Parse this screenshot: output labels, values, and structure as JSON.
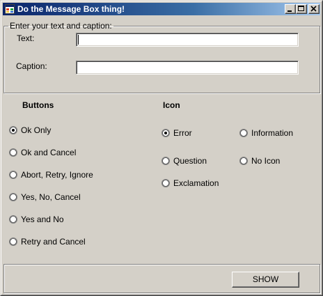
{
  "window": {
    "title": "Do the Message Box thing!"
  },
  "input_group": {
    "legend": "Enter your text and caption:",
    "text_label": "Text:",
    "text_value": "",
    "caption_label": "Caption:",
    "caption_value": ""
  },
  "buttons_group": {
    "heading": "Buttons",
    "selected": "Ok Only",
    "options": [
      "Ok Only",
      "Ok and  Cancel",
      "Abort, Retry, Ignore",
      "Yes, No, Cancel",
      "Yes and No",
      "Retry and Cancel"
    ]
  },
  "icon_group": {
    "heading": "Icon",
    "selected": "Error",
    "options": [
      "Error",
      "Information",
      "Question",
      "No Icon",
      "Exclamation"
    ]
  },
  "actions": {
    "show_label": "SHOW"
  },
  "colors": {
    "face": "#d4d0c8",
    "title_start": "#0a246a",
    "title_end": "#a6caf0"
  }
}
